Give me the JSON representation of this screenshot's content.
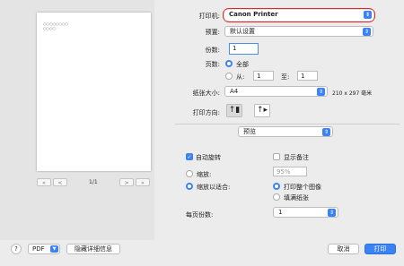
{
  "preview": {
    "text_line1": "○○○○○○○○",
    "text_line2": "○○○○",
    "nav_first": "«",
    "nav_prev": "<",
    "page_indicator": "1/1",
    "nav_next": ">",
    "nav_last": "»"
  },
  "printer": {
    "label": "打印机:",
    "value": "Canon Printer"
  },
  "presets": {
    "label": "预置:",
    "value": "默认设置"
  },
  "copies": {
    "label": "份数:",
    "value": "1"
  },
  "pages": {
    "label": "页数:",
    "all_label": "全部",
    "from_label": "从:",
    "from_value": "1",
    "to_label": "至:",
    "to_value": "1"
  },
  "paper_size": {
    "label": "纸张大小:",
    "value": "A4",
    "dimensions": "210 x 297 毫米"
  },
  "orientation": {
    "label": "打印方向:"
  },
  "section_popup": {
    "value": "预览"
  },
  "auto_rotate": {
    "label": "自动旋转"
  },
  "show_notes": {
    "label": "显示备注"
  },
  "scale": {
    "label": "缩放:",
    "value": "95%"
  },
  "scale_to_fit": {
    "label": "缩放以适合:",
    "print_entire": "打印整个图像",
    "fill_paper": "填满纸张"
  },
  "copies_per_page": {
    "label": "每页份数:",
    "value": "1"
  },
  "footer": {
    "help": "?",
    "pdf": "PDF",
    "hide_details": "隐藏详细信息",
    "cancel": "取消",
    "print": "打印"
  },
  "colors": {
    "accent": "#3b82f6",
    "highlight": "#e0262b"
  }
}
